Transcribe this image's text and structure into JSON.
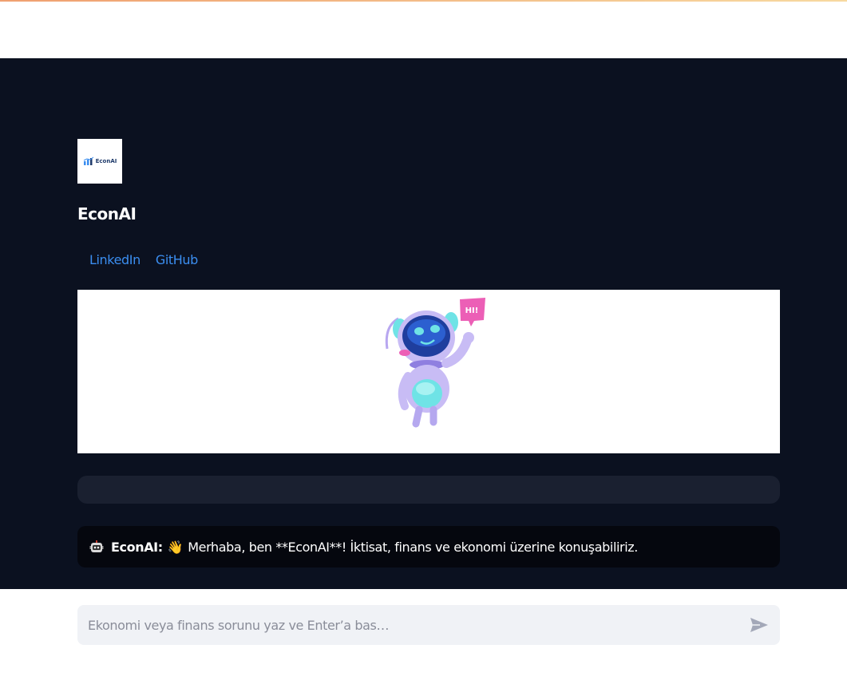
{
  "app": {
    "title": "EconAI",
    "logo_text": "EconAI"
  },
  "links": [
    {
      "label": "LinkedIn"
    },
    {
      "label": "GitHub"
    }
  ],
  "hero": {
    "badge_text": "HI!"
  },
  "chat": {
    "messages": [
      {
        "sender": "EconAI:",
        "emoji": "👋",
        "text": "Merhaba, ben **EconAI**! İktisat, finans ve ekonomi üzerine konuşabiliriz."
      }
    ]
  },
  "input": {
    "placeholder": "Ekonomi veya finans sorunu yaz ve Enter’a bas…",
    "value": ""
  },
  "colors": {
    "panel_bg": "#0b1120",
    "link": "#3b8ef0",
    "input_bg": "#f0f2f6"
  }
}
